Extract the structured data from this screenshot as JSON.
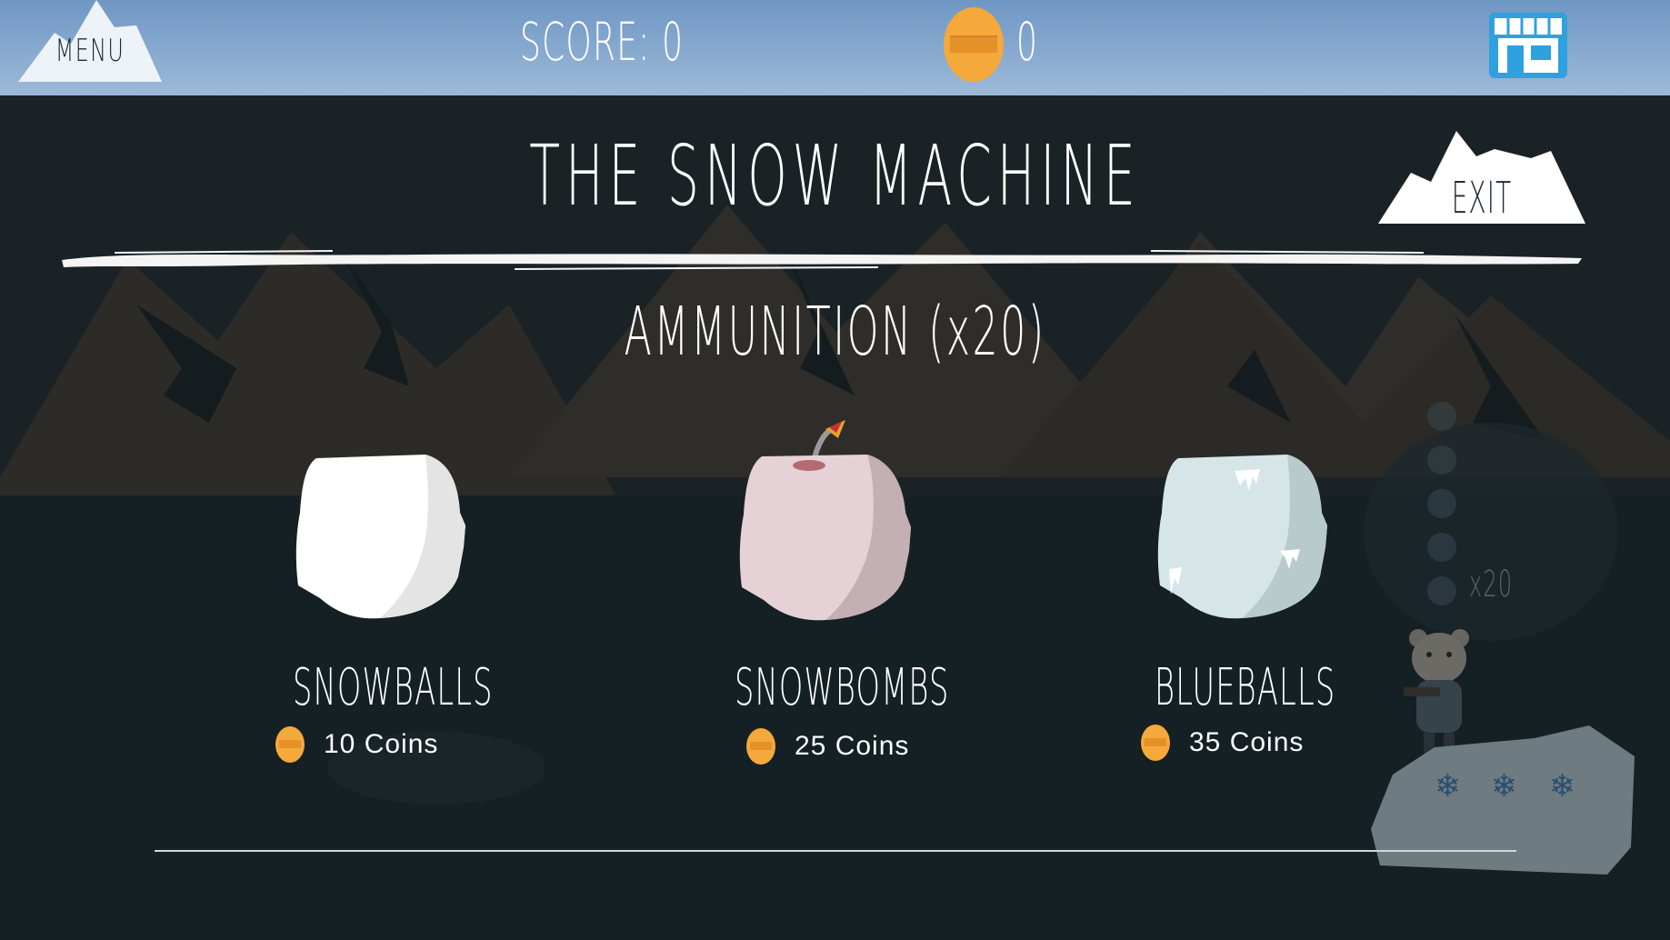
{
  "topbar": {
    "menu_label": "MENU",
    "score_text": "SCORE: 0",
    "coins": "0",
    "icons": {
      "coin": "coin-icon",
      "shop": "shop-icon"
    }
  },
  "panel": {
    "title": "THE SNOW MACHINE",
    "exit_label": "EXIT",
    "section_title": "AMMUNITION (x20)",
    "items": [
      {
        "name": "SNOWBALLS",
        "price": "10 Coins",
        "color": "#f2f2f2"
      },
      {
        "name": "SNOWBOMBS",
        "price": "25 Coins",
        "color": "#e6d2d6"
      },
      {
        "name": "BLUEBALLS",
        "price": "35 Coins",
        "color": "#d6e6e8"
      }
    ]
  },
  "hud": {
    "ammo_count": "x20"
  },
  "colors": {
    "sky_bar": "#8fb0d3",
    "coin": "#f5a93b",
    "background": "#1a2226",
    "mountain": "#2e2d2a"
  }
}
